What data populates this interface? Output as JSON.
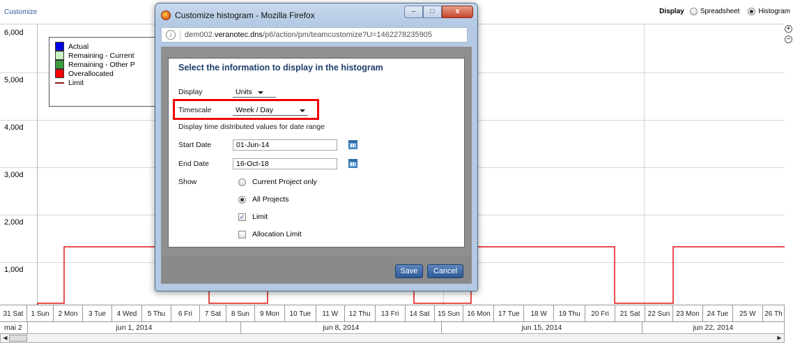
{
  "topbar": {
    "customize_label": "Customize",
    "display_label": "Display",
    "options": [
      {
        "label": "Spreadsheet",
        "selected": false
      },
      {
        "label": "Histogram",
        "selected": true
      }
    ]
  },
  "chart": {
    "y_ticks": [
      "6,00d",
      "5,00d",
      "4,00d",
      "3,00d",
      "2,00d",
      "1,00d"
    ],
    "legend": [
      {
        "label": "Actual",
        "color": "#0000e6"
      },
      {
        "label": "Remaining - Current",
        "color": "#c9f3c4"
      },
      {
        "label": "Remaining - Other P",
        "color": "#3d9a3d"
      },
      {
        "label": "Overallocated",
        "color": "#ff0000"
      },
      {
        "label": "Limit",
        "color": "#8b1a1a"
      }
    ],
    "limit_color": "#e01010",
    "zoom_in_icon": "zoom-in-icon",
    "zoom_out_icon": "zoom-out-icon"
  },
  "timeline": {
    "days": [
      "31 Sat",
      "1 Sun",
      "2 Mon",
      "3 Tue",
      "4 Wed",
      "5 Thu",
      "6 Fri",
      "7 Sat",
      "8 Sun",
      "9 Mon",
      "10 Tue",
      "11 W",
      "12 Thu",
      "13 Fri",
      "14 Sat",
      "15 Sun",
      "16 Mon",
      "17 Tue",
      "18 W",
      "19 Thu",
      "20 Fri",
      "21 Sat",
      "22 Sun",
      "23 Mon",
      "24 Tue",
      "25 W",
      "26 Th"
    ],
    "weeks": [
      "mai 2",
      "jun 1, 2014",
      "jun 8, 2014",
      "jun 15, 2014",
      "jun 22, 2014"
    ]
  },
  "firefox": {
    "title": "Customize histogram - Mozilla Firefox",
    "url_prefix": "dem002.",
    "url_domain": "veranotec.dns",
    "url_path": "/p6/action/pm/teamcustomize?U=1462278235905",
    "min_label": "–",
    "max_label": "□",
    "close_label": "x"
  },
  "dialog": {
    "heading": "Select the information to display in the histogram",
    "display_label": "Display",
    "display_value": "Units",
    "timescale_label": "Timescale",
    "timescale_value": "Week / Day",
    "range_note": "Display time distributed values for date range",
    "start_label": "Start Date",
    "start_value": "01-Jun-14",
    "end_label": "End Date",
    "end_value": "16-Oct-18",
    "show_label": "Show",
    "show_options": [
      {
        "label": "Current Project only",
        "selected": false
      },
      {
        "label": "All Projects",
        "selected": true
      }
    ],
    "checkboxes": [
      {
        "label": "Limit",
        "checked": true
      },
      {
        "label": "Allocation Limit",
        "checked": false
      }
    ],
    "save_label": "Save",
    "cancel_label": "Cancel",
    "check_mark": "✓"
  }
}
